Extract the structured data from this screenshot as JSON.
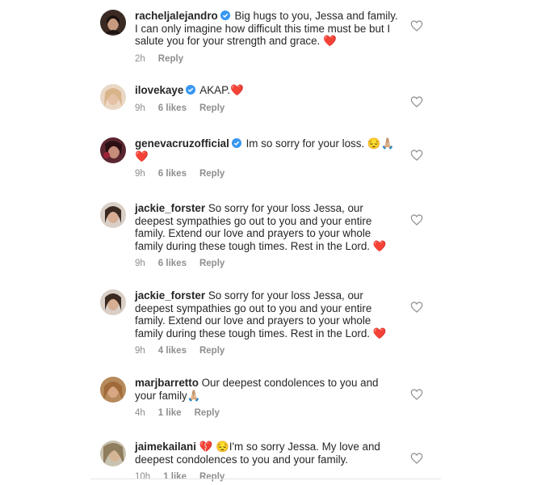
{
  "comments": [
    {
      "username": "racheljalejandro",
      "verified": true,
      "text": "Big hugs to you, Jessa and family. I can only imagine how difficult this time must be but I salute you for your strength and grace. ❤️",
      "time": "2h",
      "likes": "",
      "reply": "Reply"
    },
    {
      "username": "ilovekaye",
      "verified": true,
      "text": "AKAP.❤️",
      "time": "9h",
      "likes": "6 likes",
      "reply": "Reply"
    },
    {
      "username": "genevacruzofficial",
      "verified": true,
      "text": "Im so sorry for your loss. 😔🙏🏼❤️",
      "time": "9h",
      "likes": "6 likes",
      "reply": "Reply"
    },
    {
      "username": "jackie_forster",
      "verified": false,
      "text": "So sorry for your loss Jessa, our deepest sympathies go out to you and your entire family. Extend our love and prayers to your whole family during these tough times. Rest in the Lord. ❤️",
      "time": "9h",
      "likes": "6 likes",
      "reply": "Reply"
    },
    {
      "username": "jackie_forster",
      "verified": false,
      "text": "So sorry for your loss Jessa, our deepest sympathies go out to you and your entire family. Extend our love and prayers to your whole family during these tough times. Rest in the Lord. ❤️",
      "time": "9h",
      "likes": "4 likes",
      "reply": "Reply"
    },
    {
      "username": "marjbarretto",
      "verified": false,
      "text": "Our deepest condolences to you and your family🙏🏼",
      "time": "4h",
      "likes": "1 like",
      "reply": "Reply"
    },
    {
      "username": "jaimekailani",
      "verified": false,
      "text": "💔 😔I'm so sorry Jessa. My love and deepest condolences to you and your family.",
      "time": "10h",
      "likes": "1 like",
      "reply": "Reply"
    }
  ]
}
